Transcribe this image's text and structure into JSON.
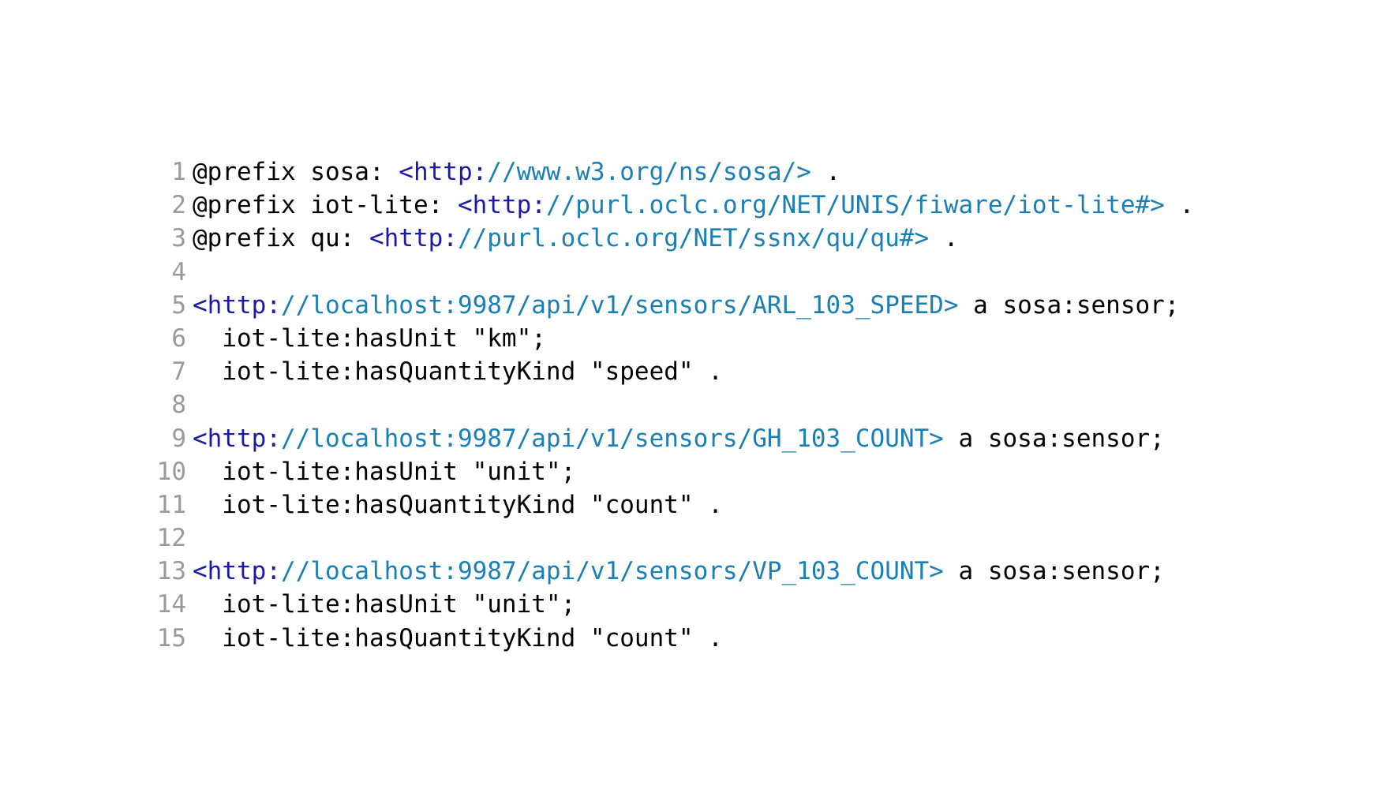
{
  "colors": {
    "iri_scheme": "#1a1aa6",
    "iri_path": "#1a7fb5",
    "text": "#000000",
    "line_number": "#9a9a9a",
    "background": "#ffffff"
  },
  "lines": [
    {
      "num": "1",
      "segments": [
        {
          "t": "@prefix sosa: ",
          "c": "plain"
        },
        {
          "t": "<http:",
          "c": "iri-open"
        },
        {
          "t": "//www.w3.org/ns/sosa/>",
          "c": "iri-body"
        },
        {
          "t": " .",
          "c": "plain"
        }
      ]
    },
    {
      "num": "2",
      "segments": [
        {
          "t": "@prefix iot-lite: ",
          "c": "plain"
        },
        {
          "t": "<http:",
          "c": "iri-open"
        },
        {
          "t": "//purl.oclc.org/NET/UNIS/fiware/iot-lite#>",
          "c": "iri-body"
        },
        {
          "t": " .",
          "c": "plain"
        }
      ]
    },
    {
      "num": "3",
      "segments": [
        {
          "t": "@prefix qu: ",
          "c": "plain"
        },
        {
          "t": "<http:",
          "c": "iri-open"
        },
        {
          "t": "//purl.oclc.org/NET/ssnx/qu/qu#>",
          "c": "iri-body"
        },
        {
          "t": " .",
          "c": "plain"
        }
      ]
    },
    {
      "num": "4",
      "segments": []
    },
    {
      "num": "5",
      "segments": [
        {
          "t": "<http:",
          "c": "iri-open"
        },
        {
          "t": "//localhost:9987/api/v1/sensors/ARL_103_SPEED>",
          "c": "iri-body"
        },
        {
          "t": " a sosa:sensor;",
          "c": "plain"
        }
      ]
    },
    {
      "num": "6",
      "segments": [
        {
          "t": "  iot-lite:hasUnit \"km\";",
          "c": "plain"
        }
      ]
    },
    {
      "num": "7",
      "segments": [
        {
          "t": "  iot-lite:hasQuantityKind \"speed\" .",
          "c": "plain"
        }
      ]
    },
    {
      "num": "8",
      "segments": []
    },
    {
      "num": "9",
      "segments": [
        {
          "t": "<http:",
          "c": "iri-open"
        },
        {
          "t": "//localhost:9987/api/v1/sensors/GH_103_COUNT>",
          "c": "iri-body"
        },
        {
          "t": " a sosa:sensor;",
          "c": "plain"
        }
      ]
    },
    {
      "num": "10",
      "segments": [
        {
          "t": "  iot-lite:hasUnit \"unit\";",
          "c": "plain"
        }
      ]
    },
    {
      "num": "11",
      "segments": [
        {
          "t": "  iot-lite:hasQuantityKind \"count\" .",
          "c": "plain"
        }
      ]
    },
    {
      "num": "12",
      "segments": []
    },
    {
      "num": "13",
      "segments": [
        {
          "t": "<http:",
          "c": "iri-open"
        },
        {
          "t": "//localhost:9987/api/v1/sensors/VP_103_COUNT>",
          "c": "iri-body"
        },
        {
          "t": " a sosa:sensor;",
          "c": "plain"
        }
      ]
    },
    {
      "num": "14",
      "segments": [
        {
          "t": "  iot-lite:hasUnit \"unit\";",
          "c": "plain"
        }
      ]
    },
    {
      "num": "15",
      "segments": [
        {
          "t": "  iot-lite:hasQuantityKind \"count\" .",
          "c": "plain"
        }
      ]
    }
  ]
}
